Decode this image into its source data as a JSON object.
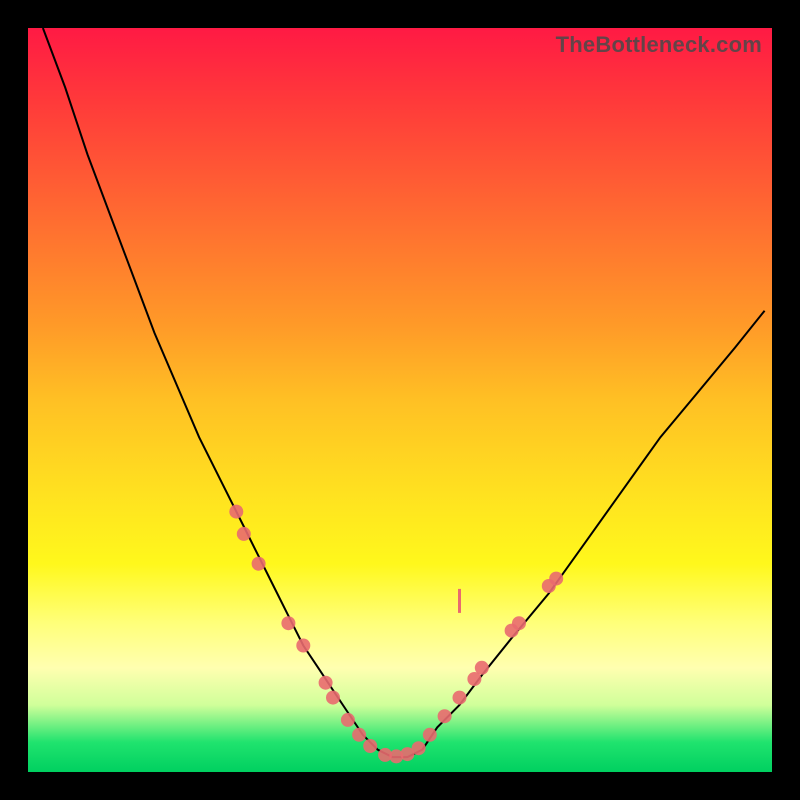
{
  "watermark": "TheBottleneck.com",
  "chart_data": {
    "type": "line",
    "title": "",
    "xlabel": "",
    "ylabel": "",
    "xlim": [
      0,
      100
    ],
    "ylim": [
      0,
      100
    ],
    "grid": false,
    "series": [
      {
        "name": "bottleneck-curve",
        "x": [
          2,
          5,
          8,
          11,
          14,
          17,
          20,
          23,
          26,
          29,
          31,
          33,
          35,
          37,
          39,
          41,
          43,
          45,
          47,
          49,
          51,
          53,
          55,
          58,
          61,
          65,
          70,
          75,
          80,
          85,
          90,
          95,
          99
        ],
        "y": [
          100,
          92,
          83,
          75,
          67,
          59,
          52,
          45,
          39,
          33,
          29,
          25,
          21,
          17,
          14,
          11,
          8,
          5,
          3,
          2,
          2,
          3,
          6,
          9,
          13,
          18,
          24,
          31,
          38,
          45,
          51,
          57,
          62
        ],
        "color": "#000000"
      }
    ],
    "markers": {
      "name": "highlight-dots",
      "color": "#e96a6f",
      "radius_px": 7,
      "points": [
        {
          "x": 28,
          "y": 35
        },
        {
          "x": 29,
          "y": 32
        },
        {
          "x": 31,
          "y": 28
        },
        {
          "x": 35,
          "y": 20
        },
        {
          "x": 37,
          "y": 17
        },
        {
          "x": 40,
          "y": 12
        },
        {
          "x": 41,
          "y": 10
        },
        {
          "x": 43,
          "y": 7
        },
        {
          "x": 44.5,
          "y": 5
        },
        {
          "x": 46,
          "y": 3.5
        },
        {
          "x": 48,
          "y": 2.3
        },
        {
          "x": 49.5,
          "y": 2.1
        },
        {
          "x": 51,
          "y": 2.4
        },
        {
          "x": 52.5,
          "y": 3.2
        },
        {
          "x": 54,
          "y": 5
        },
        {
          "x": 56,
          "y": 7.5
        },
        {
          "x": 58,
          "y": 10
        },
        {
          "x": 60,
          "y": 12.5
        },
        {
          "x": 61,
          "y": 14
        },
        {
          "x": 65,
          "y": 19
        },
        {
          "x": 66,
          "y": 20
        },
        {
          "x": 70,
          "y": 25
        },
        {
          "x": 71,
          "y": 26
        }
      ]
    },
    "annotations": [
      {
        "kind": "vline-short",
        "x": 58,
        "y": 23,
        "color": "#e96a6f"
      }
    ]
  }
}
